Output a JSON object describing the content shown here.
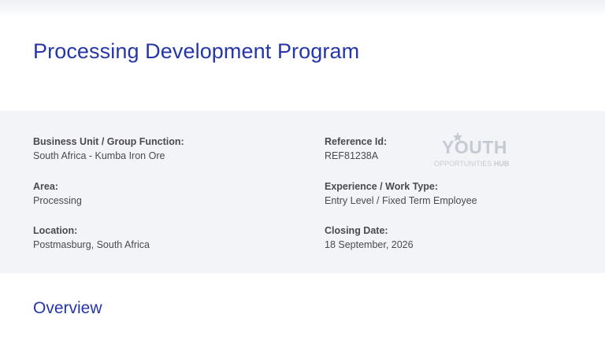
{
  "page": {
    "title": "Processing Development Program"
  },
  "details": {
    "business_unit": {
      "label": "Business Unit / Group Function:",
      "value": "South Africa - Kumba Iron Ore"
    },
    "area": {
      "label": "Area:",
      "value": "Processing"
    },
    "location": {
      "label": "Location:",
      "value": "Postmasburg, South Africa"
    },
    "reference_id": {
      "label": "Reference Id:",
      "value": "REF81238A"
    },
    "experience": {
      "label": "Experience / Work Type:",
      "value": "Entry Level / Fixed Term Employee"
    },
    "closing_date": {
      "label": "Closing Date:",
      "value": "18 September, 2026"
    }
  },
  "watermark": {
    "main": "YOUTH",
    "sub_prefix": "OPPORTUNITIES ",
    "sub_bold": "HUB"
  },
  "overview": {
    "heading": "Overview"
  },
  "colors": {
    "heading_blue": "#2536a8",
    "panel_bg": "#f3f4f7",
    "text": "#4a4a4f"
  }
}
